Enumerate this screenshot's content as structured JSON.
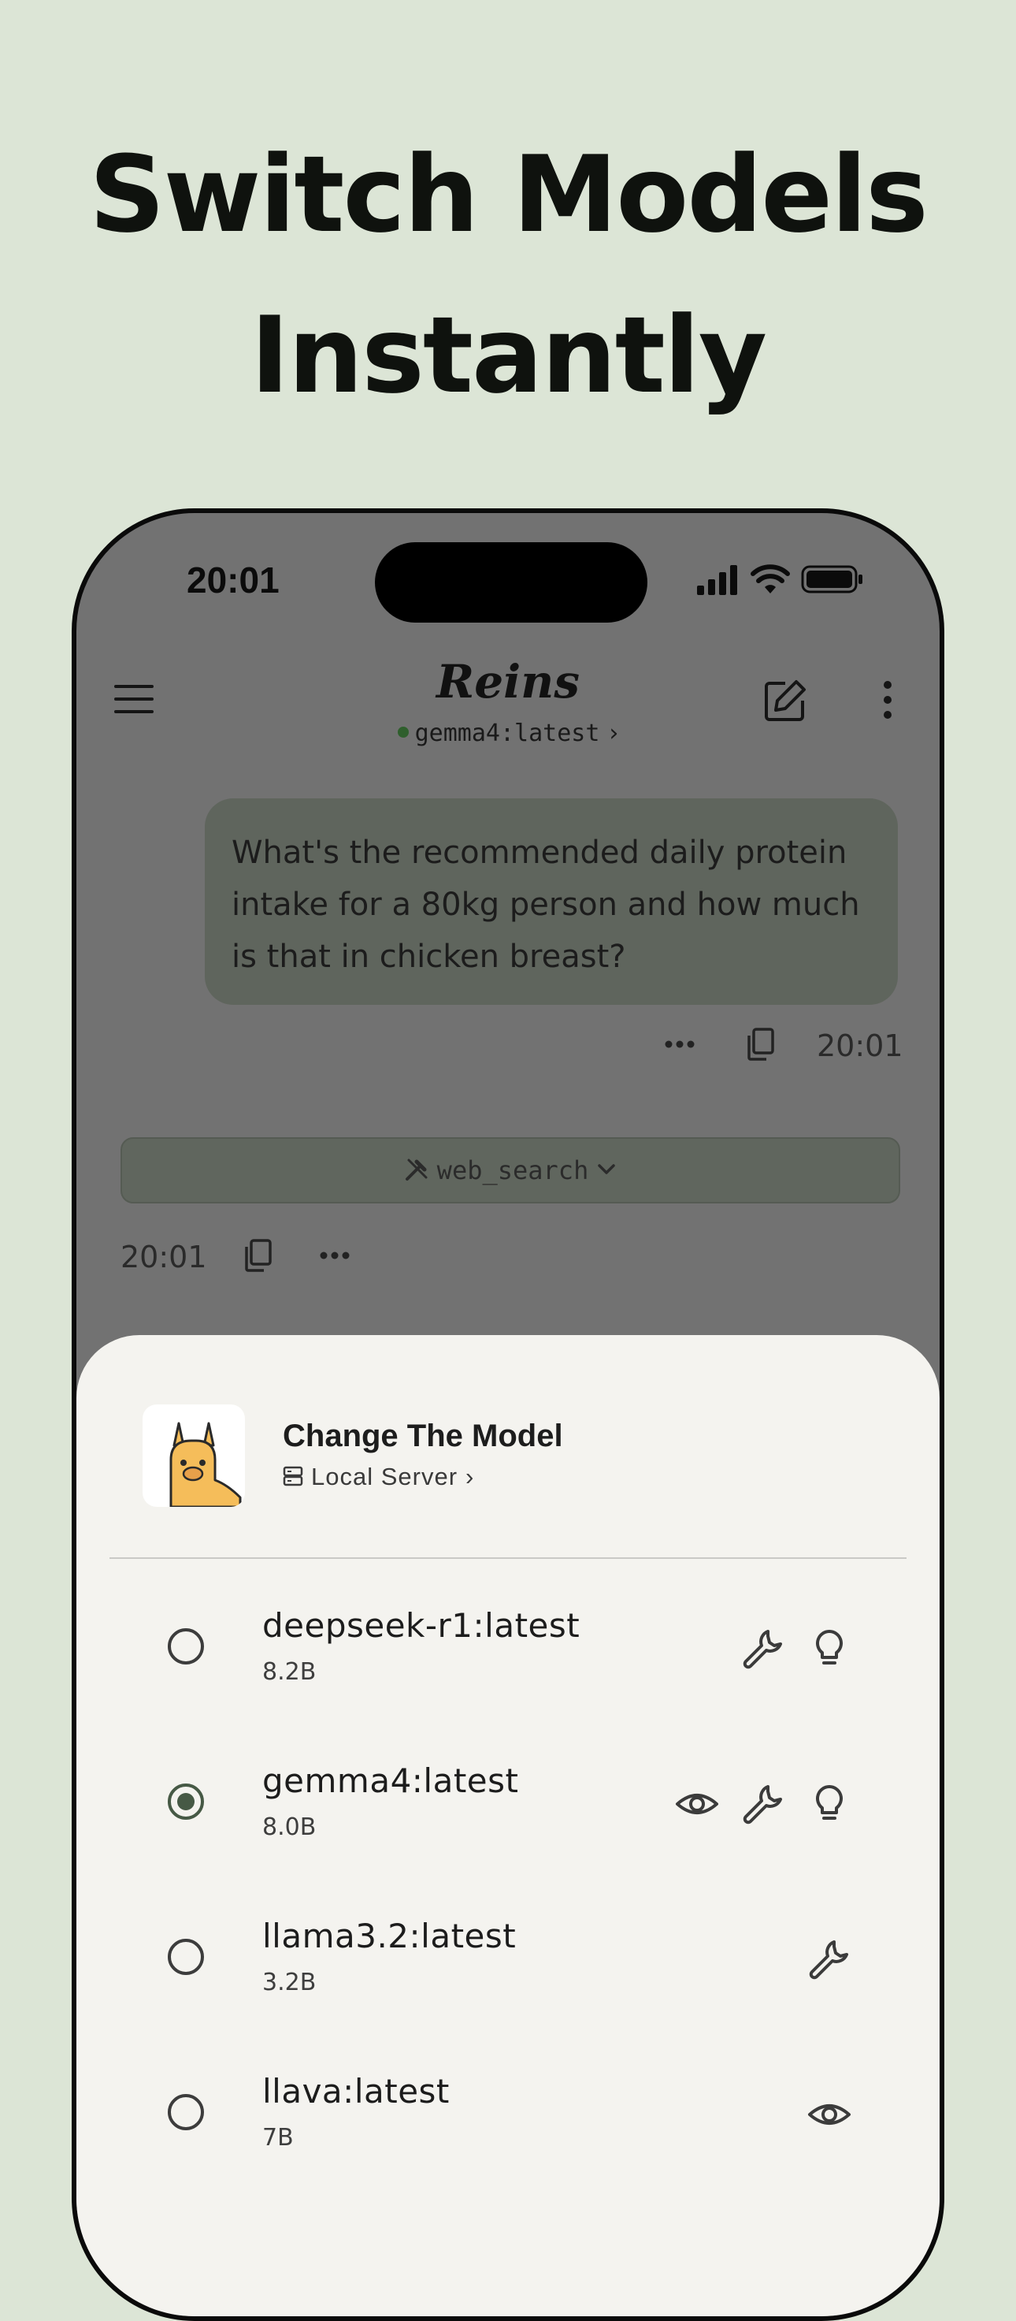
{
  "headline": {
    "line1": "Switch Models",
    "line2": "Instantly"
  },
  "status_bar": {
    "time": "20:01",
    "icons": [
      "signal-icon",
      "wifi-icon",
      "battery-icon"
    ]
  },
  "app_bar": {
    "title": "Reins",
    "model": "gemma4:latest",
    "menu_icon": "menu-icon",
    "new_chat_icon": "compose-icon",
    "more_icon": "more-vertical-icon"
  },
  "chat": {
    "user_message": "What's the recommended daily protein intake for a 80kg person and how much is that in chicken breast?",
    "user_message_time": "20:01",
    "tool_call": "web_search",
    "reply_time": "20:01"
  },
  "sheet": {
    "title": "Change The Model",
    "server": "Local Server",
    "models": [
      {
        "name": "deepseek-r1:latest",
        "size": "8.2B",
        "selected": false,
        "capabilities": [
          "tools",
          "thinking"
        ]
      },
      {
        "name": "gemma4:latest",
        "size": "8.0B",
        "selected": true,
        "capabilities": [
          "vision",
          "tools",
          "thinking"
        ]
      },
      {
        "name": "llama3.2:latest",
        "size": "3.2B",
        "selected": false,
        "capabilities": [
          "tools"
        ]
      },
      {
        "name": "llava:latest",
        "size": "7B",
        "selected": false,
        "capabilities": [
          "vision"
        ]
      }
    ]
  },
  "colors": {
    "background": "#dce5d6",
    "overlay": "#727272",
    "sheet": "#f4f3ef",
    "accent": "#465945",
    "online_dot": "#2f5f2d"
  }
}
